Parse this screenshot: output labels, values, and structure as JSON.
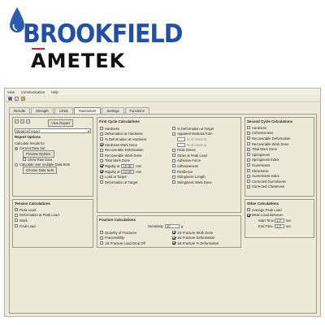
{
  "logo": {
    "brand": "BROOKFIELD",
    "company": "AMETEK"
  },
  "menu": [
    "View",
    "Communication",
    "Help"
  ],
  "tabs": [
    "Results",
    "Strength",
    "Limits",
    "Parameters",
    "Settings",
    "Functions"
  ],
  "left": {
    "dropdown": "Metafcell report",
    "view_report": "View Report",
    "report_options_title": "Report Options",
    "calc_for": "Calculate results for",
    "current_data": "Current Data Set",
    "print_preview": "Preview Options",
    "show_raw": "Show Raw Data",
    "multi_data": "Calculate over multiple Data Sets",
    "choose_data": "Choose Data Sets",
    "tension_title": "Tension Calculations",
    "tension_items": [
      "Peak Load",
      "Deformation at Peak Load",
      "Work",
      "Final Load"
    ]
  },
  "first_cycle": {
    "title": "First Cycle Calculations",
    "col1": [
      {
        "label": "Hardness",
        "on": false
      },
      {
        "label": "Deformation at Hardness",
        "on": false
      },
      {
        "label": "% Deformation at Hardness",
        "on": false
      },
      {
        "label": "Hardness Work Done",
        "on": true
      },
      {
        "label": "Recoverable Deformation",
        "on": false
      },
      {
        "label": "Recoverable Work Done",
        "on": false
      },
      {
        "label": "Total Work Done",
        "on": false
      },
      {
        "label": "Rigidity at",
        "on": true,
        "value": "10.00",
        "unit": "mm"
      },
      {
        "label": "Rigidity at",
        "on": true,
        "value": "12.00",
        "unit": "mm"
      },
      {
        "label": "Load at Target",
        "on": false
      },
      {
        "label": "Deformation at Target",
        "on": false
      }
    ],
    "col2": [
      {
        "label": "% Deformation at Target",
        "on": false
      },
      {
        "label": "Apparent Modulus from",
        "on": false
      },
      {
        "label": "",
        "sub": "% of strain to"
      },
      {
        "label": "",
        "sub": "% of strain to"
      },
      {
        "label": "Peak Stress",
        "on": false
      },
      {
        "label": "Strain at Peak Load",
        "on": false
      },
      {
        "label": "Adhesive Force",
        "on": false
      },
      {
        "label": "Adhesiveness",
        "on": false
      },
      {
        "label": "Resilience",
        "on": false
      },
      {
        "label": "Stringiness Length",
        "on": false
      },
      {
        "label": "Stringiness Work Done",
        "on": false
      }
    ]
  },
  "fracture": {
    "title": "Fracture Calculations",
    "sensitivity_label": "Sensitivity",
    "sensitivity_value": "10",
    "sensitivity_unit": "g",
    "col1": [
      "Quantity of Fractures",
      "Fracturability",
      "1st Fracture Load Drop Off"
    ],
    "col2": [
      {
        "label": "1st Fracture Work Done",
        "on": true
      },
      {
        "label": "1st Fracture Deformation",
        "on": true
      },
      {
        "label": "1st Fracture % Deformation",
        "on": true
      }
    ]
  },
  "second_cycle": {
    "title": "Second Cycle Calculations",
    "items": [
      "Hardness",
      "Cohesiveness",
      "Recoverable Deformation",
      "Recoverable Work Done",
      "Total Work Done",
      "Springiness",
      "Springiness Index",
      "Gumminess",
      "Chewiness",
      "Gumminess Index",
      "Corrected Gumminess",
      "Corrected Chewiness"
    ]
  },
  "other": {
    "title": "Other Calculations",
    "items": [
      {
        "label": "Average Peak Load",
        "on": false
      },
      {
        "label": "Mean Load Between",
        "on": true
      }
    ],
    "start_label": "Start Time",
    "start_value": "1.0",
    "start_unit": "sec",
    "end_label": "End Time",
    "end_value": "1.0",
    "end_unit": "sec"
  },
  "colors": {
    "brand_blue": "#2350a0",
    "window_bg": "#ece9d8"
  },
  "icons": [
    "water-drop-icon",
    "new-icon",
    "open-icon",
    "save-icon",
    "print-icon"
  ]
}
